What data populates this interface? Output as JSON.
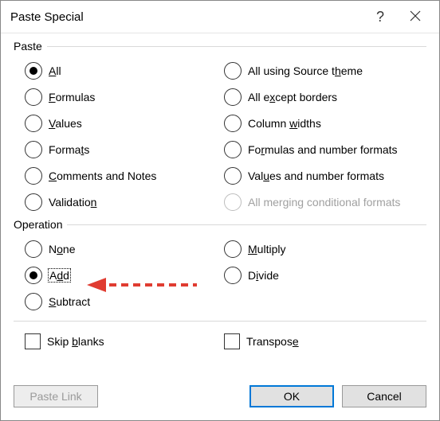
{
  "title": "Paste Special",
  "groups": {
    "paste": {
      "label": "Paste",
      "options_left": [
        {
          "label_pre": "",
          "accel": "A",
          "label_post": "ll",
          "checked": true,
          "disabled": false,
          "name": "radio-all"
        },
        {
          "label_pre": "",
          "accel": "F",
          "label_post": "ormulas",
          "checked": false,
          "disabled": false,
          "name": "radio-formulas"
        },
        {
          "label_pre": "",
          "accel": "V",
          "label_post": "alues",
          "checked": false,
          "disabled": false,
          "name": "radio-values"
        },
        {
          "label_pre": "Forma",
          "accel": "t",
          "label_post": "s",
          "checked": false,
          "disabled": false,
          "name": "radio-formats"
        },
        {
          "label_pre": "",
          "accel": "C",
          "label_post": "omments and Notes",
          "checked": false,
          "disabled": false,
          "name": "radio-comments"
        },
        {
          "label_pre": "Validatio",
          "accel": "n",
          "label_post": "",
          "checked": false,
          "disabled": false,
          "name": "radio-validation"
        }
      ],
      "options_right": [
        {
          "label_pre": "All using Source t",
          "accel": "h",
          "label_post": "eme",
          "checked": false,
          "disabled": false,
          "name": "radio-source-theme"
        },
        {
          "label_pre": "All e",
          "accel": "x",
          "label_post": "cept borders",
          "checked": false,
          "disabled": false,
          "name": "radio-except-borders"
        },
        {
          "label_pre": "Column ",
          "accel": "w",
          "label_post": "idths",
          "checked": false,
          "disabled": false,
          "name": "radio-column-widths"
        },
        {
          "label_pre": "Fo",
          "accel": "r",
          "label_post": "mulas and number formats",
          "checked": false,
          "disabled": false,
          "name": "radio-formulas-number-formats"
        },
        {
          "label_pre": "Val",
          "accel": "u",
          "label_post": "es and number formats",
          "checked": false,
          "disabled": false,
          "name": "radio-values-number-formats"
        },
        {
          "label_pre": "All mer",
          "accel": "g",
          "label_post": "ing conditional formats",
          "checked": false,
          "disabled": true,
          "name": "radio-merging-conditional"
        }
      ]
    },
    "operation": {
      "label": "Operation",
      "options_left": [
        {
          "label_pre": "N",
          "accel": "o",
          "label_post": "ne",
          "checked": false,
          "disabled": false,
          "name": "radio-none",
          "focus": false
        },
        {
          "label_pre": "A",
          "accel": "d",
          "label_post": "d",
          "checked": true,
          "disabled": false,
          "name": "radio-add",
          "focus": true
        },
        {
          "label_pre": "",
          "accel": "S",
          "label_post": "ubtract",
          "checked": false,
          "disabled": false,
          "name": "radio-subtract",
          "focus": false
        }
      ],
      "options_right": [
        {
          "label_pre": "",
          "accel": "M",
          "label_post": "ultiply",
          "checked": false,
          "disabled": false,
          "name": "radio-multiply"
        },
        {
          "label_pre": "D",
          "accel": "i",
          "label_post": "vide",
          "checked": false,
          "disabled": false,
          "name": "radio-divide"
        }
      ]
    }
  },
  "checkboxes": {
    "skip_blanks": {
      "label_pre": "Skip ",
      "accel": "b",
      "label_post": "lanks",
      "checked": false
    },
    "transpose": {
      "label_pre": "Transpos",
      "accel": "e",
      "label_post": "",
      "checked": false
    }
  },
  "buttons": {
    "paste_link": "Paste Link",
    "ok": "OK",
    "cancel": "Cancel"
  },
  "annotation": {
    "color": "#E03C31"
  }
}
